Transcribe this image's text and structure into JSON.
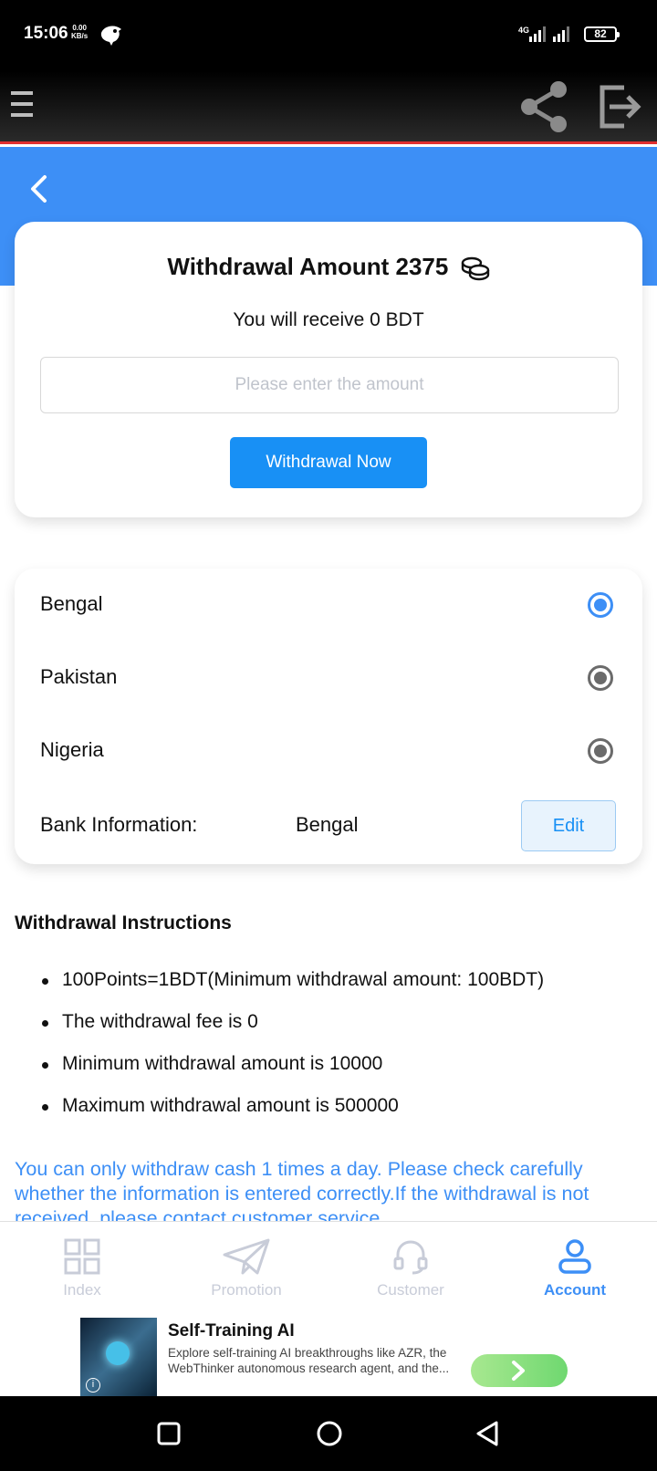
{
  "status_bar": {
    "time": "15:06",
    "net_speed_value": "0.00",
    "net_speed_unit": "KB/s",
    "network": "4G",
    "battery": "82"
  },
  "card_withdraw": {
    "title": "Withdrawal Amount 2375",
    "receive_text": "You will receive 0 BDT",
    "amount_placeholder": "Please enter the amount",
    "withdraw_button": "Withdrawal Now"
  },
  "bank_options": [
    {
      "label": "Bengal",
      "selected": true
    },
    {
      "label": "Pakistan",
      "selected": false
    },
    {
      "label": "Nigeria",
      "selected": false
    }
  ],
  "bank_info": {
    "label": "Bank Information:",
    "value": "Bengal",
    "edit_button": "Edit"
  },
  "instructions": {
    "title": "Withdrawal Instructions",
    "items": [
      "100Points=1BDT(Minimum withdrawal amount: 100BDT)",
      "The withdrawal fee is 0",
      "Minimum withdrawal amount is 10000",
      "Maximum withdrawal amount is 500000"
    ],
    "notice": "You can only withdraw cash 1 times a day. Please check carefully whether the information is entered correctly.If the withdrawal is not received, please contact customer service."
  },
  "bottom_nav": [
    {
      "label": "Index",
      "active": false
    },
    {
      "label": "Promotion",
      "active": false
    },
    {
      "label": "Customer",
      "active": false
    },
    {
      "label": "Account",
      "active": true
    }
  ],
  "ad": {
    "title": "Self-Training AI",
    "description": "Explore self-training AI breakthroughs like AZR, the WebThinker autonomous research agent, and the..."
  },
  "colors": {
    "accent": "#3d8ff6",
    "button": "#1890f5",
    "topbar_border": "#e03030"
  }
}
